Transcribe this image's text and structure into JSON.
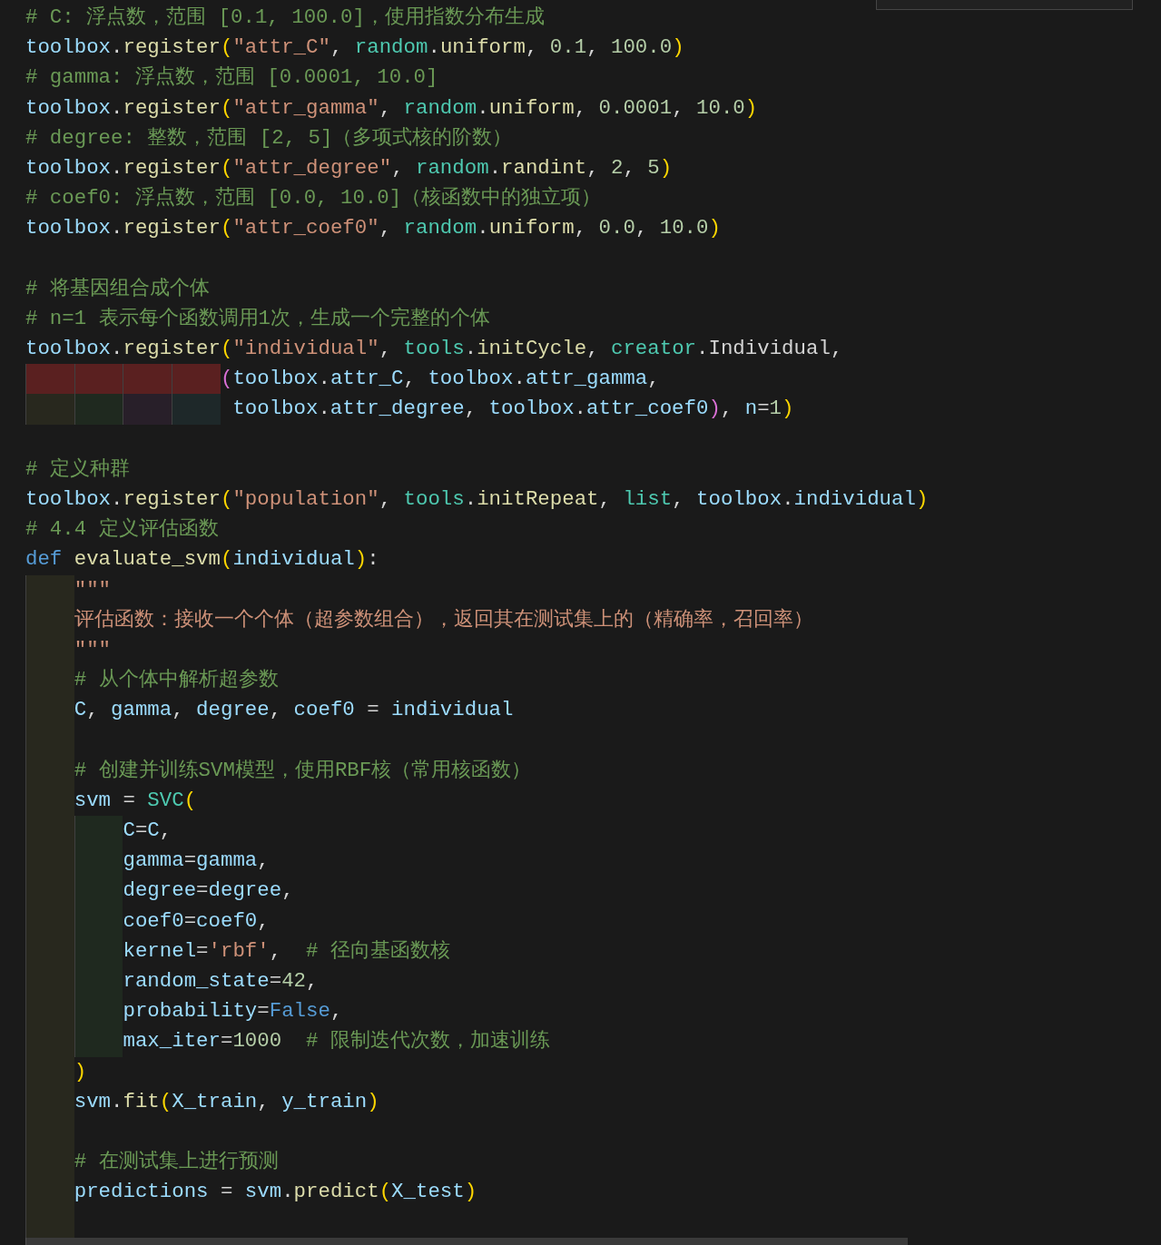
{
  "find_widget": {
    "visible": true
  },
  "lines": [
    {
      "kind": "code",
      "t": [
        {
          "text": "# C: 浮点数，范围 [0.1, 100.0]，使用指数分布生成",
          "kind": "comment"
        }
      ]
    },
    {
      "kind": "code",
      "t": [
        {
          "text": "toolbox",
          "kind": "variable"
        },
        {
          "text": ".",
          "kind": "plain"
        },
        {
          "text": "register",
          "kind": "function"
        },
        {
          "text": "(",
          "kind": "bracket1"
        },
        {
          "text": "\"attr_C\"",
          "kind": "string"
        },
        {
          "text": ", ",
          "kind": "plain"
        },
        {
          "text": "random",
          "kind": "type"
        },
        {
          "text": ".",
          "kind": "plain"
        },
        {
          "text": "uniform",
          "kind": "function"
        },
        {
          "text": ", ",
          "kind": "plain"
        },
        {
          "text": "0.1",
          "kind": "number"
        },
        {
          "text": ", ",
          "kind": "plain"
        },
        {
          "text": "100.0",
          "kind": "number"
        },
        {
          "text": ")",
          "kind": "bracket1"
        }
      ]
    },
    {
      "kind": "code",
      "t": [
        {
          "text": "# gamma: 浮点数，范围 [0.0001, 10.0]",
          "kind": "comment"
        }
      ]
    },
    {
      "kind": "code",
      "t": [
        {
          "text": "toolbox",
          "kind": "variable"
        },
        {
          "text": ".",
          "kind": "plain"
        },
        {
          "text": "register",
          "kind": "function"
        },
        {
          "text": "(",
          "kind": "bracket1"
        },
        {
          "text": "\"attr_gamma\"",
          "kind": "string"
        },
        {
          "text": ", ",
          "kind": "plain"
        },
        {
          "text": "random",
          "kind": "type"
        },
        {
          "text": ".",
          "kind": "plain"
        },
        {
          "text": "uniform",
          "kind": "function"
        },
        {
          "text": ", ",
          "kind": "plain"
        },
        {
          "text": "0.0001",
          "kind": "number"
        },
        {
          "text": ", ",
          "kind": "plain"
        },
        {
          "text": "10.0",
          "kind": "number"
        },
        {
          "text": ")",
          "kind": "bracket1"
        }
      ]
    },
    {
      "kind": "code",
      "t": [
        {
          "text": "# degree: 整数，范围 [2, 5]（多项式核的阶数）",
          "kind": "comment"
        }
      ]
    },
    {
      "kind": "code",
      "t": [
        {
          "text": "toolbox",
          "kind": "variable"
        },
        {
          "text": ".",
          "kind": "plain"
        },
        {
          "text": "register",
          "kind": "function"
        },
        {
          "text": "(",
          "kind": "bracket1"
        },
        {
          "text": "\"attr_degree\"",
          "kind": "string"
        },
        {
          "text": ", ",
          "kind": "plain"
        },
        {
          "text": "random",
          "kind": "type"
        },
        {
          "text": ".",
          "kind": "plain"
        },
        {
          "text": "randint",
          "kind": "function"
        },
        {
          "text": ", ",
          "kind": "plain"
        },
        {
          "text": "2",
          "kind": "number"
        },
        {
          "text": ", ",
          "kind": "plain"
        },
        {
          "text": "5",
          "kind": "number"
        },
        {
          "text": ")",
          "kind": "bracket1"
        }
      ]
    },
    {
      "kind": "code",
      "t": [
        {
          "text": "# coef0: 浮点数，范围 [0.0, 10.0]（核函数中的独立项）",
          "kind": "comment"
        }
      ]
    },
    {
      "kind": "code",
      "t": [
        {
          "text": "toolbox",
          "kind": "variable"
        },
        {
          "text": ".",
          "kind": "plain"
        },
        {
          "text": "register",
          "kind": "function"
        },
        {
          "text": "(",
          "kind": "bracket1"
        },
        {
          "text": "\"attr_coef0\"",
          "kind": "string"
        },
        {
          "text": ", ",
          "kind": "plain"
        },
        {
          "text": "random",
          "kind": "type"
        },
        {
          "text": ".",
          "kind": "plain"
        },
        {
          "text": "uniform",
          "kind": "function"
        },
        {
          "text": ", ",
          "kind": "plain"
        },
        {
          "text": "0.0",
          "kind": "number"
        },
        {
          "text": ", ",
          "kind": "plain"
        },
        {
          "text": "10.0",
          "kind": "number"
        },
        {
          "text": ")",
          "kind": "bracket1"
        }
      ]
    },
    {
      "kind": "blank"
    },
    {
      "kind": "code",
      "t": [
        {
          "text": "# 将基因组合成个体",
          "kind": "comment"
        }
      ]
    },
    {
      "kind": "code",
      "t": [
        {
          "text": "# n=1 表示每个函数调用1次，生成一个完整的个体",
          "kind": "comment"
        }
      ]
    },
    {
      "kind": "code",
      "t": [
        {
          "text": "toolbox",
          "kind": "variable"
        },
        {
          "text": ".",
          "kind": "plain"
        },
        {
          "text": "register",
          "kind": "function"
        },
        {
          "text": "(",
          "kind": "bracket1"
        },
        {
          "text": "\"individual\"",
          "kind": "string"
        },
        {
          "text": ", ",
          "kind": "plain"
        },
        {
          "text": "tools",
          "kind": "type"
        },
        {
          "text": ".",
          "kind": "plain"
        },
        {
          "text": "initCycle",
          "kind": "function"
        },
        {
          "text": ", ",
          "kind": "plain"
        },
        {
          "text": "creator",
          "kind": "type"
        },
        {
          "text": ".",
          "kind": "plain"
        },
        {
          "text": "Individual",
          "kind": "plain"
        },
        {
          "text": ",",
          "kind": "plain"
        }
      ]
    },
    {
      "kind": "code",
      "g": [
        {
          "kind": "error"
        },
        {
          "kind": "error"
        },
        {
          "kind": "error"
        },
        {
          "kind": "error"
        }
      ],
      "t": [
        {
          "text": "(",
          "kind": "bracket2"
        },
        {
          "text": "toolbox",
          "kind": "variable"
        },
        {
          "text": ".",
          "kind": "plain"
        },
        {
          "text": "attr_C",
          "kind": "variable"
        },
        {
          "text": ", ",
          "kind": "plain"
        },
        {
          "text": "toolbox",
          "kind": "variable"
        },
        {
          "text": ".",
          "kind": "plain"
        },
        {
          "text": "attr_gamma",
          "kind": "variable"
        },
        {
          "text": ",",
          "kind": "plain"
        }
      ]
    },
    {
      "kind": "code",
      "hang": true,
      "g": [
        {
          "kind": "level1"
        },
        {
          "kind": "level2"
        },
        {
          "kind": "level3"
        },
        {
          "kind": "level4"
        }
      ],
      "t": [
        {
          "text": "toolbox",
          "kind": "variable"
        },
        {
          "text": ".",
          "kind": "plain"
        },
        {
          "text": "attr_degree",
          "kind": "variable"
        },
        {
          "text": ", ",
          "kind": "plain"
        },
        {
          "text": "toolbox",
          "kind": "variable"
        },
        {
          "text": ".",
          "kind": "plain"
        },
        {
          "text": "attr_coef0",
          "kind": "variable"
        },
        {
          "text": ")",
          "kind": "bracket2"
        },
        {
          "text": ", ",
          "kind": "plain"
        },
        {
          "text": "n",
          "kind": "variable"
        },
        {
          "text": "=",
          "kind": "plain"
        },
        {
          "text": "1",
          "kind": "number"
        },
        {
          "text": ")",
          "kind": "bracket1"
        }
      ]
    },
    {
      "kind": "blank"
    },
    {
      "kind": "code",
      "t": [
        {
          "text": "# 定义种群",
          "kind": "comment"
        }
      ]
    },
    {
      "kind": "code",
      "t": [
        {
          "text": "toolbox",
          "kind": "variable"
        },
        {
          "text": ".",
          "kind": "plain"
        },
        {
          "text": "register",
          "kind": "function"
        },
        {
          "text": "(",
          "kind": "bracket1"
        },
        {
          "text": "\"population\"",
          "kind": "string"
        },
        {
          "text": ", ",
          "kind": "plain"
        },
        {
          "text": "tools",
          "kind": "type"
        },
        {
          "text": ".",
          "kind": "plain"
        },
        {
          "text": "initRepeat",
          "kind": "function"
        },
        {
          "text": ", ",
          "kind": "plain"
        },
        {
          "text": "list",
          "kind": "type"
        },
        {
          "text": ", ",
          "kind": "plain"
        },
        {
          "text": "toolbox",
          "kind": "variable"
        },
        {
          "text": ".",
          "kind": "plain"
        },
        {
          "text": "individual",
          "kind": "variable"
        },
        {
          "text": ")",
          "kind": "bracket1"
        }
      ]
    },
    {
      "kind": "code",
      "t": [
        {
          "text": "# 4.4 定义评估函数",
          "kind": "comment"
        }
      ]
    },
    {
      "kind": "code",
      "t": [
        {
          "text": "def ",
          "kind": "keyword"
        },
        {
          "text": "evaluate_svm",
          "kind": "function"
        },
        {
          "text": "(",
          "kind": "bracket1"
        },
        {
          "text": "individual",
          "kind": "variable"
        },
        {
          "text": ")",
          "kind": "bracket1"
        },
        {
          "text": ":",
          "kind": "plain"
        }
      ]
    },
    {
      "kind": "code",
      "g": [
        {
          "kind": "level1"
        }
      ],
      "t": [
        {
          "text": "\"\"\"",
          "kind": "string"
        }
      ]
    },
    {
      "kind": "code",
      "g": [
        {
          "kind": "level1"
        }
      ],
      "t": [
        {
          "text": "评估函数：接收一个个体（超参数组合），返回其在测试集上的（精确率，召回率）",
          "kind": "string"
        }
      ]
    },
    {
      "kind": "code",
      "g": [
        {
          "kind": "level1"
        }
      ],
      "t": [
        {
          "text": "\"\"\"",
          "kind": "string"
        }
      ]
    },
    {
      "kind": "code",
      "g": [
        {
          "kind": "level1"
        }
      ],
      "t": [
        {
          "text": "# 从个体中解析超参数",
          "kind": "comment"
        }
      ]
    },
    {
      "kind": "code",
      "g": [
        {
          "kind": "level1"
        }
      ],
      "t": [
        {
          "text": "C",
          "kind": "variable"
        },
        {
          "text": ", ",
          "kind": "plain"
        },
        {
          "text": "gamma",
          "kind": "variable"
        },
        {
          "text": ", ",
          "kind": "plain"
        },
        {
          "text": "degree",
          "kind": "variable"
        },
        {
          "text": ", ",
          "kind": "plain"
        },
        {
          "text": "coef0",
          "kind": "variable"
        },
        {
          "text": " = ",
          "kind": "plain"
        },
        {
          "text": "individual",
          "kind": "variable"
        }
      ]
    },
    {
      "kind": "blank",
      "g": [
        {
          "kind": "level1"
        }
      ]
    },
    {
      "kind": "code",
      "g": [
        {
          "kind": "level1"
        }
      ],
      "t": [
        {
          "text": "# 创建并训练SVM模型，使用RBF核（常用核函数）",
          "kind": "comment"
        }
      ]
    },
    {
      "kind": "code",
      "g": [
        {
          "kind": "level1"
        }
      ],
      "t": [
        {
          "text": "svm",
          "kind": "variable"
        },
        {
          "text": " = ",
          "kind": "plain"
        },
        {
          "text": "SVC",
          "kind": "type"
        },
        {
          "text": "(",
          "kind": "bracket1"
        }
      ]
    },
    {
      "kind": "code",
      "g": [
        {
          "kind": "level1"
        },
        {
          "kind": "level2"
        }
      ],
      "t": [
        {
          "text": "C",
          "kind": "variable"
        },
        {
          "text": "=",
          "kind": "plain"
        },
        {
          "text": "C",
          "kind": "variable"
        },
        {
          "text": ",",
          "kind": "plain"
        }
      ]
    },
    {
      "kind": "code",
      "g": [
        {
          "kind": "level1"
        },
        {
          "kind": "level2"
        }
      ],
      "t": [
        {
          "text": "gamma",
          "kind": "variable"
        },
        {
          "text": "=",
          "kind": "plain"
        },
        {
          "text": "gamma",
          "kind": "variable"
        },
        {
          "text": ",",
          "kind": "plain"
        }
      ]
    },
    {
      "kind": "code",
      "g": [
        {
          "kind": "level1"
        },
        {
          "kind": "level2"
        }
      ],
      "t": [
        {
          "text": "degree",
          "kind": "variable"
        },
        {
          "text": "=",
          "kind": "plain"
        },
        {
          "text": "degree",
          "kind": "variable"
        },
        {
          "text": ",",
          "kind": "plain"
        }
      ]
    },
    {
      "kind": "code",
      "g": [
        {
          "kind": "level1"
        },
        {
          "kind": "level2"
        }
      ],
      "t": [
        {
          "text": "coef0",
          "kind": "variable"
        },
        {
          "text": "=",
          "kind": "plain"
        },
        {
          "text": "coef0",
          "kind": "variable"
        },
        {
          "text": ",",
          "kind": "plain"
        }
      ]
    },
    {
      "kind": "code",
      "g": [
        {
          "kind": "level1"
        },
        {
          "kind": "level2"
        }
      ],
      "t": [
        {
          "text": "kernel",
          "kind": "variable"
        },
        {
          "text": "=",
          "kind": "plain"
        },
        {
          "text": "'rbf'",
          "kind": "string"
        },
        {
          "text": ",",
          "kind": "plain"
        },
        {
          "text": "  # 径向基函数核",
          "kind": "comment"
        }
      ]
    },
    {
      "kind": "code",
      "g": [
        {
          "kind": "level1"
        },
        {
          "kind": "level2"
        }
      ],
      "t": [
        {
          "text": "random_state",
          "kind": "variable"
        },
        {
          "text": "=",
          "kind": "plain"
        },
        {
          "text": "42",
          "kind": "number"
        },
        {
          "text": ",",
          "kind": "plain"
        }
      ]
    },
    {
      "kind": "code",
      "g": [
        {
          "kind": "level1"
        },
        {
          "kind": "level2"
        }
      ],
      "t": [
        {
          "text": "probability",
          "kind": "variable"
        },
        {
          "text": "=",
          "kind": "plain"
        },
        {
          "text": "False",
          "kind": "keyword"
        },
        {
          "text": ",",
          "kind": "plain"
        }
      ]
    },
    {
      "kind": "code",
      "g": [
        {
          "kind": "level1"
        },
        {
          "kind": "level2"
        }
      ],
      "t": [
        {
          "text": "max_iter",
          "kind": "variable"
        },
        {
          "text": "=",
          "kind": "plain"
        },
        {
          "text": "1000",
          "kind": "number"
        },
        {
          "text": "  # 限制迭代次数，加速训练",
          "kind": "comment"
        }
      ]
    },
    {
      "kind": "code",
      "g": [
        {
          "kind": "level1"
        }
      ],
      "t": [
        {
          "text": ")",
          "kind": "bracket1"
        }
      ]
    },
    {
      "kind": "code",
      "g": [
        {
          "kind": "level1"
        }
      ],
      "t": [
        {
          "text": "svm",
          "kind": "variable"
        },
        {
          "text": ".",
          "kind": "plain"
        },
        {
          "text": "fit",
          "kind": "function"
        },
        {
          "text": "(",
          "kind": "bracket1"
        },
        {
          "text": "X_train",
          "kind": "variable"
        },
        {
          "text": ", ",
          "kind": "plain"
        },
        {
          "text": "y_train",
          "kind": "variable"
        },
        {
          "text": ")",
          "kind": "bracket1"
        }
      ]
    },
    {
      "kind": "blank",
      "g": [
        {
          "kind": "level1"
        }
      ]
    },
    {
      "kind": "code",
      "g": [
        {
          "kind": "level1"
        }
      ],
      "t": [
        {
          "text": "# 在测试集上进行预测",
          "kind": "comment"
        }
      ]
    },
    {
      "kind": "code",
      "g": [
        {
          "kind": "level1"
        }
      ],
      "t": [
        {
          "text": "predictions",
          "kind": "variable"
        },
        {
          "text": " = ",
          "kind": "plain"
        },
        {
          "text": "svm",
          "kind": "variable"
        },
        {
          "text": ".",
          "kind": "plain"
        },
        {
          "text": "predict",
          "kind": "function"
        },
        {
          "text": "(",
          "kind": "bracket1"
        },
        {
          "text": "X_test",
          "kind": "variable"
        },
        {
          "text": ")",
          "kind": "bracket1"
        }
      ]
    },
    {
      "kind": "blank",
      "g": [
        {
          "kind": "level1"
        }
      ]
    },
    {
      "kind": "blank",
      "g": [
        {
          "kind": "level1"
        }
      ],
      "highlighted": true
    }
  ]
}
